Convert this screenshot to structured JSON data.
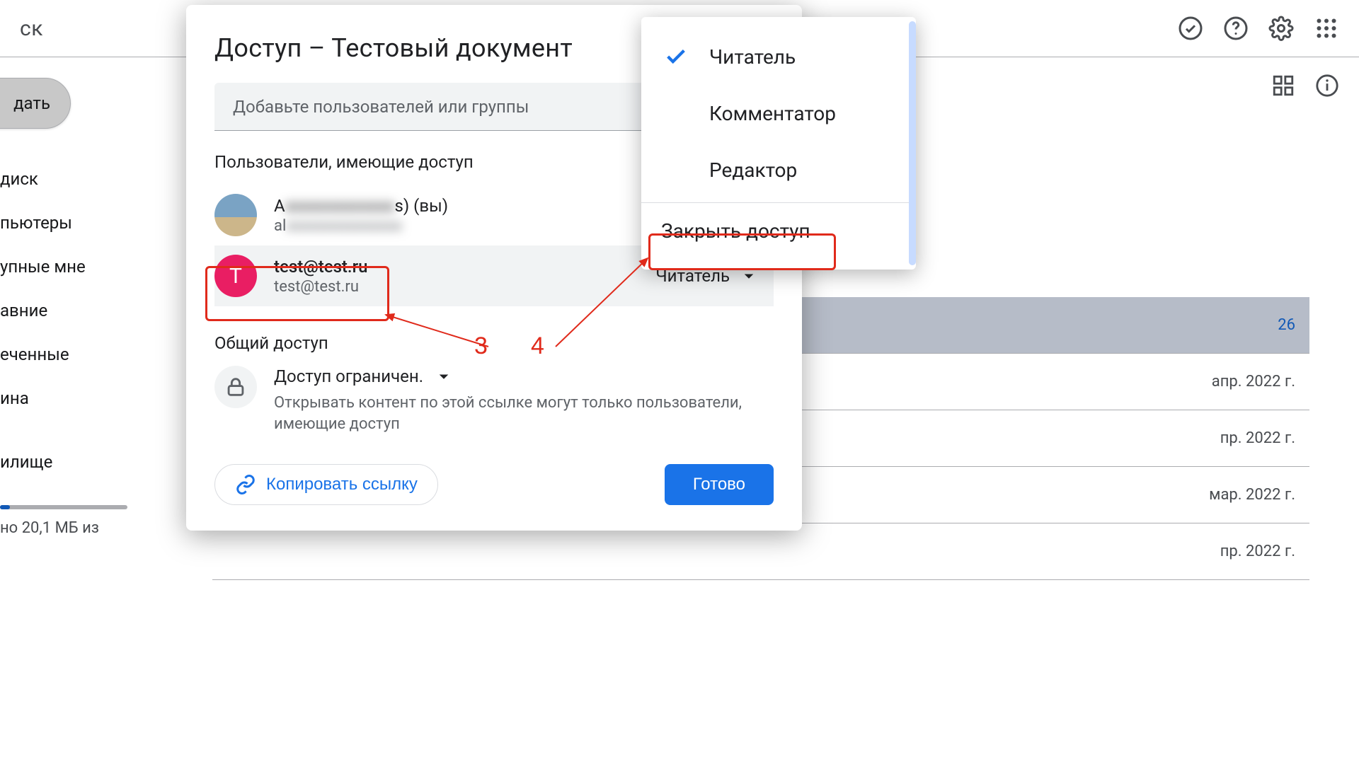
{
  "bg": {
    "logo_fragment": "ск",
    "new_btn": "дать",
    "sidebar": [
      "диск",
      "пьютеры",
      "упные мне",
      "авние",
      "еченные",
      "ина",
      "илище"
    ],
    "storage_used": "но 20,1 МБ из",
    "file_dates": [
      "26",
      "апр. 2022 г.",
      "пр. 2022 г.",
      "мар. 2022 г.",
      "пр. 2022 г."
    ]
  },
  "dialog": {
    "title": "Доступ – Тестовый документ",
    "add_placeholder": "Добавьте пользователей или группы",
    "people_heading": "Пользователи, имеющие доступ",
    "owner": {
      "name_prefix": "A",
      "name_blur": "xxxxxxxxxxxxx",
      "name_suffix": "s) (вы)",
      "email_prefix": "al",
      "email_blur": "xxxxxxxxxxxxxxx"
    },
    "user2": {
      "initial": "T",
      "name": "test@test.ru",
      "email": "test@test.ru",
      "role": "Читатель"
    },
    "general_heading": "Общий доступ",
    "restricted_label": "Доступ ограничен.",
    "restricted_desc": "Открывать контент по этой ссылке могут только пользователи, имеющие доступ",
    "copy_link": "Копировать ссылку",
    "done": "Готово"
  },
  "menu": {
    "reader": "Читатель",
    "commenter": "Комментатор",
    "editor": "Редактор",
    "remove": "Закрыть доступ"
  },
  "annot": {
    "n3": "3",
    "n4": "4"
  }
}
